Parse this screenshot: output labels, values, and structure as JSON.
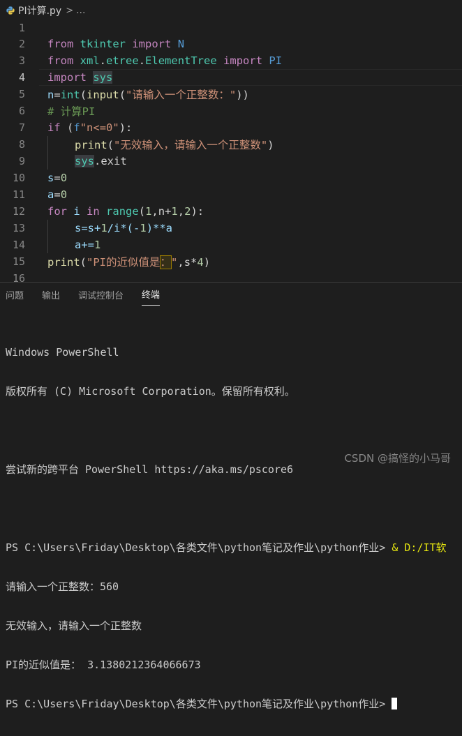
{
  "breadcrumb": {
    "file": "PI计算.py",
    "separator": ">",
    "more": "..."
  },
  "editor": {
    "current_line": 4,
    "lines": [
      {
        "n": "1"
      },
      {
        "n": "2",
        "t": {
          "a": "from",
          "b": "tkinter",
          "c": "import",
          "d": "N"
        }
      },
      {
        "n": "3",
        "t": {
          "a": "from",
          "b": "xml",
          "c": ".",
          "d": "etree",
          "e": ".",
          "f": "ElementTree",
          "g": "import",
          "h": "PI"
        }
      },
      {
        "n": "4",
        "t": {
          "a": "import",
          "b": "sys"
        }
      },
      {
        "n": "5",
        "t": {
          "a": "n",
          "b": "=",
          "c": "int",
          "d": "(",
          "e": "input",
          "f": "(",
          "g": "\"请输入一个正整数：\"",
          "h": "))"
        }
      },
      {
        "n": "6",
        "t": {
          "a": "# 计算PI"
        }
      },
      {
        "n": "7",
        "t": {
          "a": "if",
          "b": "(",
          "c": "f",
          "d": "\"n<=0\"",
          "e": "):"
        }
      },
      {
        "n": "8",
        "t": {
          "a": "print",
          "b": "(",
          "c": "\"无效输入，请输入一个正整数\"",
          "d": ")"
        }
      },
      {
        "n": "9",
        "t": {
          "a": "sys",
          "b": ".exit"
        }
      },
      {
        "n": "10",
        "t": {
          "a": "s",
          "b": "=",
          "c": "0"
        }
      },
      {
        "n": "11",
        "t": {
          "a": "a",
          "b": "=",
          "c": "0"
        }
      },
      {
        "n": "12",
        "t": {
          "a": "for",
          "b": "i",
          "c": "in",
          "d": "range",
          "e": "(",
          "f": "1",
          "g": ",n+",
          "h": "1",
          "i": ",",
          "j": "2",
          "k": "):"
        }
      },
      {
        "n": "13",
        "t": {
          "a": "s=s+",
          "b": "1",
          "c": "/i*(-",
          "d": "1",
          "e": ")**a"
        }
      },
      {
        "n": "14",
        "t": {
          "a": "a+=",
          "b": "1"
        }
      },
      {
        "n": "15",
        "t": {
          "a": "print",
          "b": "(",
          "c": "\"PI的近似值是",
          "d": "：",
          "e": "\"",
          "f": ",s*",
          "g": "4",
          "h": ")"
        }
      },
      {
        "n": "16"
      }
    ]
  },
  "panel": {
    "tabs": [
      "问题",
      "输出",
      "调试控制台",
      "终端"
    ],
    "active_tab": "终端"
  },
  "terminal": {
    "l1": "Windows PowerShell",
    "l2": "版权所有 (C) Microsoft Corporation。保留所有权利。",
    "l3": "尝试新的跨平台 PowerShell https://aka.ms/pscore6",
    "l4a": "PS C:\\Users\\Friday\\Desktop\\各类文件\\python笔记及作业\\python作业> ",
    "l4b": "& D:/IT软",
    "l5": "请输入一个正整数：560",
    "l6": "无效输入，请输入一个正整数",
    "l7": "PI的近似值是： 3.1380212364066673",
    "l8": "PS C:\\Users\\Friday\\Desktop\\各类文件\\python笔记及作业\\python作业> "
  },
  "watermark": "CSDN @搞怪的小马哥",
  "colors": {
    "background": "#1e1e1e",
    "keyword_control": "#c586c0",
    "keyword": "#569cd6",
    "function": "#dcdcaa",
    "string": "#ce9178",
    "number": "#b5cea8",
    "variable": "#9cdcfe",
    "type": "#4ec9b0",
    "comment": "#6a9955"
  }
}
